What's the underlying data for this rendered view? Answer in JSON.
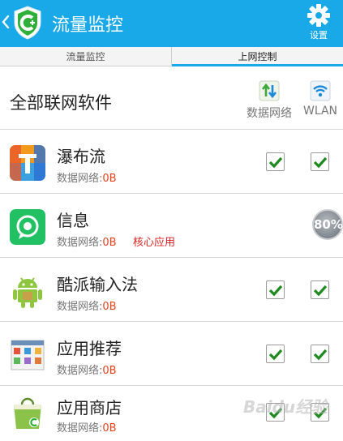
{
  "header": {
    "title": "流量监控",
    "settings_label": "设置"
  },
  "tabs": [
    {
      "label": "流量监控",
      "active": false
    },
    {
      "label": "上网控制",
      "active": true
    }
  ],
  "list_header": {
    "title": "全部联网软件",
    "col_mobile": "数据网络",
    "col_wlan": "WLAN"
  },
  "apps": [
    {
      "name": "瀑布流",
      "usage_label": "数据网络:",
      "usage_value": "0B",
      "mobile": true,
      "wlan": true
    },
    {
      "name": "信息",
      "usage_label": "数据网络:",
      "usage_value": "0B",
      "tag": "核心应用",
      "badge": "80%"
    },
    {
      "name": "酷派输入法",
      "usage_label": "数据网络:",
      "usage_value": "0B",
      "mobile": true,
      "wlan": true
    },
    {
      "name": "应用推荐",
      "usage_label": "数据网络:",
      "usage_value": "0B",
      "mobile": true,
      "wlan": true
    },
    {
      "name": "应用商店",
      "usage_label": "数据网络:",
      "usage_value": "0B",
      "mobile": true,
      "wlan": true
    }
  ],
  "watermark": "Baidu经验",
  "colors": {
    "titlebar": "#1aa9e8",
    "accent": "#1aa9e8",
    "checkmark": "#1f8a1f",
    "usage_value": "#e2431f",
    "core_tag": "#d82020"
  }
}
